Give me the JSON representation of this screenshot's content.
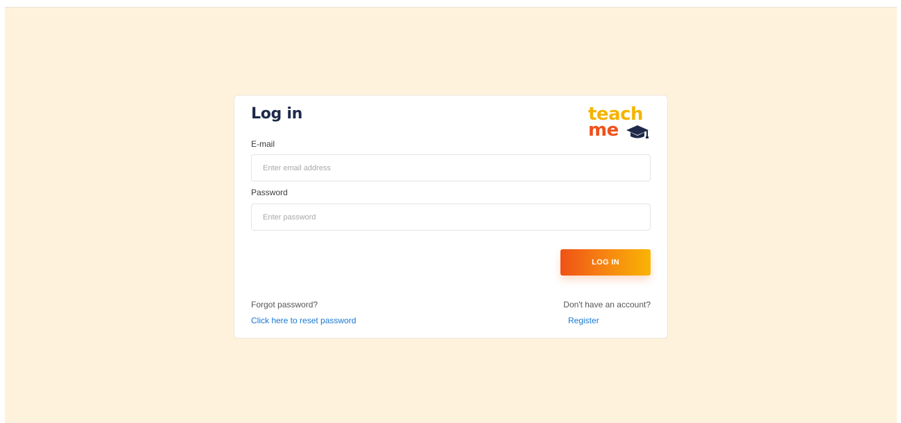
{
  "login": {
    "title": "Log in",
    "logo": {
      "line1": "teach",
      "line2": "me",
      "icon": "graduation-cap-icon"
    },
    "email": {
      "label": "E-mail",
      "placeholder": "Enter email address",
      "value": ""
    },
    "password": {
      "label": "Password",
      "placeholder": "Enter password",
      "value": ""
    },
    "submit_label": "LOG IN",
    "forgot": {
      "text": "Forgot password?",
      "link": "Click here to reset password"
    },
    "register": {
      "text": "Don't have an account?",
      "link": "Register"
    }
  },
  "colors": {
    "background": "#fff2dc",
    "title": "#1f2a4a",
    "logo_teach": "#f4b400",
    "logo_me": "#f0511b",
    "button_gradient_start": "#ef5216",
    "button_gradient_end": "#f9b403",
    "link": "#1677d2"
  }
}
